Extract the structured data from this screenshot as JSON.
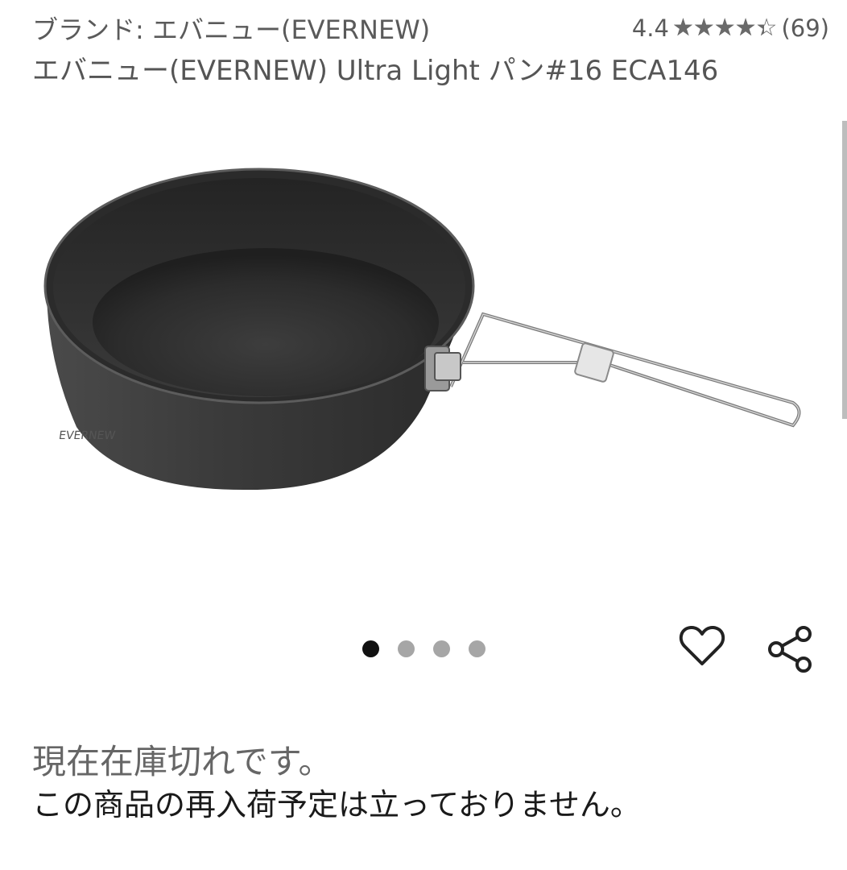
{
  "header": {
    "brand_line": "ブランド: エバニュー(EVERNEW)",
    "rating_value": "4.4",
    "rating_fraction": 0.88,
    "stars_glyphs": "★★★★★",
    "review_count": "(69)",
    "product_title": "エバニュー(EVERNEW) Ultra Light パン#16 ECA146"
  },
  "gallery": {
    "image_count": 4,
    "active_index": 0,
    "image_alt": "product-photo-frying-pan"
  },
  "actions": {
    "favorite_icon": "heart-outline-icon",
    "share_icon": "share-icon"
  },
  "stock": {
    "status": "現在在庫切れです。",
    "restock_note": "この商品の再入荷予定は立っておりません。"
  },
  "colors": {
    "text_primary": "#1a1a1a",
    "text_secondary": "#555555",
    "dot_active": "#111111",
    "dot_inactive": "#a6a6a6"
  }
}
